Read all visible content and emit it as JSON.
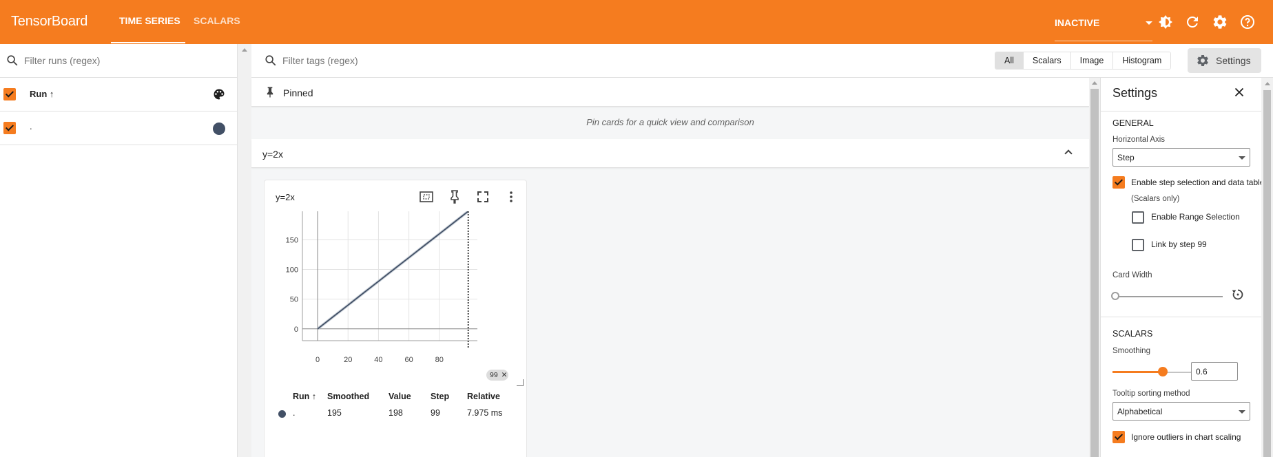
{
  "app": {
    "brand": "TensorBoard",
    "tabs": [
      {
        "label": "TIME SERIES",
        "active": true
      },
      {
        "label": "SCALARS",
        "active": false
      }
    ],
    "status_select": "INACTIVE",
    "icons": [
      "theme-toggle-icon",
      "refresh-icon",
      "settings-gear-icon",
      "help-icon"
    ],
    "accent_color": "#f57c1f"
  },
  "left": {
    "filter_placeholder": "Filter runs (regex)",
    "header_label": "Run",
    "sort_arrow": "↑",
    "runs": [
      {
        "name": ".",
        "checked": true,
        "color": "#425066"
      }
    ]
  },
  "main": {
    "filter_placeholder": "Filter tags (regex)",
    "type_filters": [
      "All",
      "Scalars",
      "Image",
      "Histogram"
    ],
    "selected_type": "All",
    "settings_button": "Settings",
    "pinned_label": "Pinned",
    "pinned_empty": "Pin cards for a quick view and comparison",
    "group_label": "y=2x"
  },
  "card": {
    "title": "y=2x",
    "step_chip": "99",
    "step_chip_close": "✕",
    "table": {
      "headers": [
        "Run",
        "Smoothed",
        "Value",
        "Step",
        "Relative"
      ],
      "header_sort_arrow": "↑",
      "row": {
        "run": ".",
        "smoothed": "195",
        "value": "198",
        "step": "99",
        "relative": "7.975 ms"
      }
    }
  },
  "chart_data": {
    "type": "line",
    "title": "y=2x",
    "x_ticks": [
      "0",
      "20",
      "40",
      "60",
      "80"
    ],
    "y_ticks": [
      "0",
      "50",
      "100",
      "150"
    ],
    "xlim": [
      -10,
      105
    ],
    "ylim": [
      -20,
      198
    ],
    "selected_step": 99,
    "series": [
      {
        "name": ".",
        "color": "#425066",
        "x": [
          0,
          10,
          20,
          30,
          40,
          50,
          60,
          70,
          80,
          90,
          99
        ],
        "y": [
          0,
          20,
          40,
          60,
          80,
          100,
          120,
          140,
          160,
          180,
          198
        ]
      }
    ]
  },
  "settings": {
    "title": "Settings",
    "general_header": "GENERAL",
    "horizontal_axis_label": "Horizontal Axis",
    "horizontal_axis_value": "Step",
    "enable_step_selection": "Enable step selection and data table",
    "scalars_only": "(Scalars only)",
    "enable_range_selection": "Enable Range Selection",
    "link_by_step": "Link by step 99",
    "card_width_label": "Card Width",
    "scalars_header": "SCALARS",
    "smoothing_label": "Smoothing",
    "smoothing_value": "0.6",
    "smoothing_fraction": 0.6,
    "tooltip_sort_label": "Tooltip sorting method",
    "tooltip_sort_value": "Alphabetical",
    "ignore_outliers": "Ignore outliers in chart scaling"
  }
}
